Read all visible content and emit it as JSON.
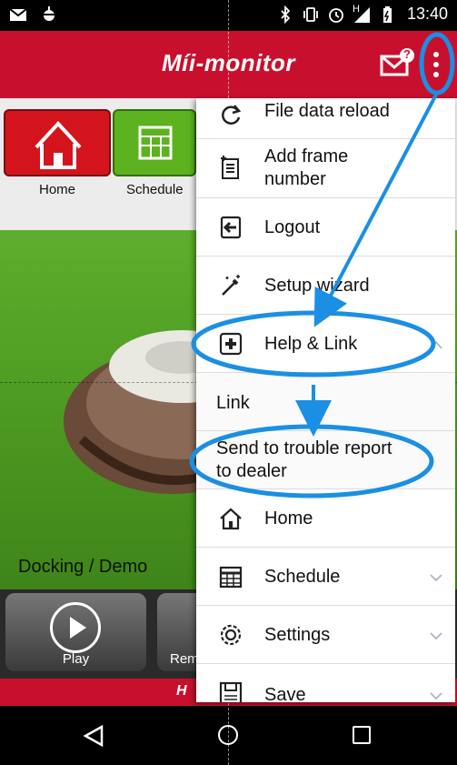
{
  "status_bar": {
    "time": "13:40",
    "left_icons": [
      "mail-notification-icon",
      "android-debug-icon"
    ],
    "right_icons": [
      "bluetooth-icon",
      "vibrate-icon",
      "alarm-icon",
      "signal-icon",
      "battery-icon"
    ],
    "signal_label": "H"
  },
  "app_bar": {
    "title": "Mii-monitor",
    "title_display": "Míi-monitor",
    "brand_color": "#c8102e",
    "mail_badge": "?"
  },
  "tiles": {
    "home_label": "Home",
    "schedule_label": "Schedule"
  },
  "main": {
    "status_text": "Docking / Demo"
  },
  "bottom_buttons": {
    "play_label": "Play",
    "remote_label_visible": "Rem"
  },
  "drawer": {
    "items": [
      {
        "label": "File data reload",
        "icon": "reload-icon"
      },
      {
        "label": "Add frame\nnumber",
        "icon": "add-document-icon"
      },
      {
        "label": "Logout",
        "icon": "logout-icon"
      },
      {
        "label": "Setup wizard",
        "icon": "magic-wand-icon"
      },
      {
        "label": "Help & Link",
        "icon": "help-plus-icon",
        "expanded": true
      },
      {
        "label": "Link",
        "icon": ""
      },
      {
        "label": "Send to trouble report\nto dealer",
        "icon": ""
      },
      {
        "label": "Home",
        "icon": "home-icon"
      },
      {
        "label": "Schedule",
        "icon": "schedule-icon",
        "expandable": true
      },
      {
        "label": "Settings",
        "icon": "settings-icon",
        "expandable": true
      },
      {
        "label": "Save",
        "icon": "save-icon",
        "expandable": true
      }
    ]
  },
  "annotation": {
    "color": "#1a8fe3"
  }
}
